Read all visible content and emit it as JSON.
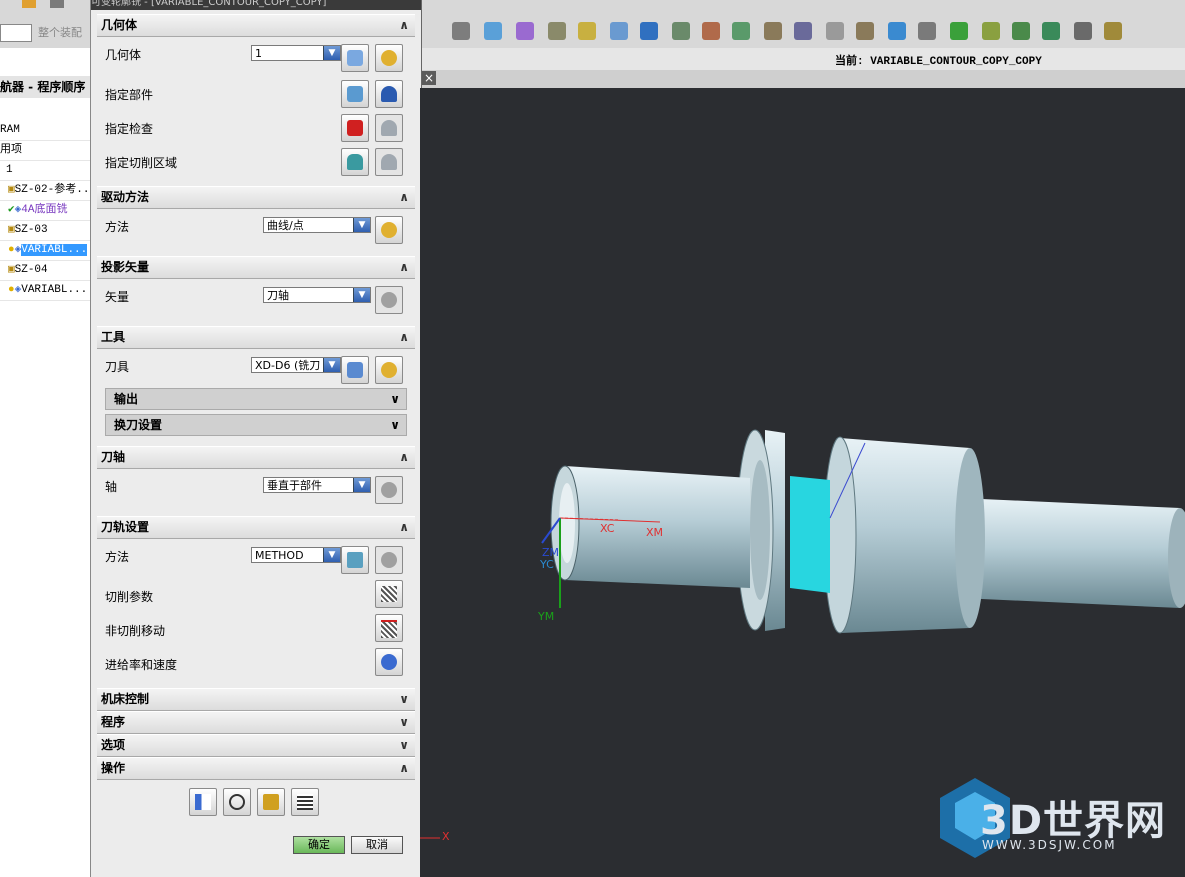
{
  "toolbar": {
    "filter_placeholder": "整个装配"
  },
  "dialog": {
    "title": "可变轮廓铣 - [VARIABLE_CONTOUR_COPY_COPY]",
    "sections": {
      "geometry": {
        "header": "几何体",
        "geom_label": "几何体",
        "geom_value": "1",
        "part_label": "指定部件",
        "check_label": "指定检查",
        "cut_area_label": "指定切削区域"
      },
      "drive": {
        "header": "驱动方法",
        "method_label": "方法",
        "method_value": "曲线/点"
      },
      "projection": {
        "header": "投影矢量",
        "vector_label": "矢量",
        "vector_value": "刀轴"
      },
      "tool": {
        "header": "工具",
        "tool_label": "刀具",
        "tool_value": "XD-D6 (铣刀",
        "output_label": "输出",
        "toolchange_label": "换刀设置"
      },
      "axis": {
        "header": "刀轴",
        "axis_label": "轴",
        "axis_value": "垂直于部件"
      },
      "path": {
        "header": "刀轨设置",
        "method_label": "方法",
        "method_value": "METHOD",
        "cut_params_label": "切削参数",
        "noncut_label": "非切削移动",
        "feeds_label": "进给率和速度"
      },
      "machine": {
        "header": "机床控制"
      },
      "program": {
        "header": "程序"
      },
      "options": {
        "header": "选项"
      },
      "actions": {
        "header": "操作"
      }
    },
    "ok_label": "确定",
    "cancel_label": "取消"
  },
  "navigator": {
    "title": "航器 - 程序顺序",
    "rows": [
      {
        "text": "RAM",
        "selected": false
      },
      {
        "text": "用项",
        "selected": false
      },
      {
        "text": "1",
        "selected": false
      },
      {
        "text": "SZ-02-参考...",
        "selected": false
      },
      {
        "text": "4A底面铣",
        "selected": false
      },
      {
        "text": "SZ-03",
        "selected": false
      },
      {
        "text": "VARIABL...",
        "selected": true
      },
      {
        "text": "SZ-04",
        "selected": false
      },
      {
        "text": "VARIABL...",
        "selected": false
      }
    ]
  },
  "status": {
    "current": "当前: VARIABLE_CONTOUR_COPY_COPY"
  },
  "viewport": {
    "axes": {
      "xc": "XC",
      "xm": "XM",
      "zm": "ZM",
      "yc": "YC",
      "ym": "YM",
      "x": "X"
    },
    "watermark": {
      "brand": "3D世界网",
      "url": "WWW.3DSJW.COM"
    }
  }
}
